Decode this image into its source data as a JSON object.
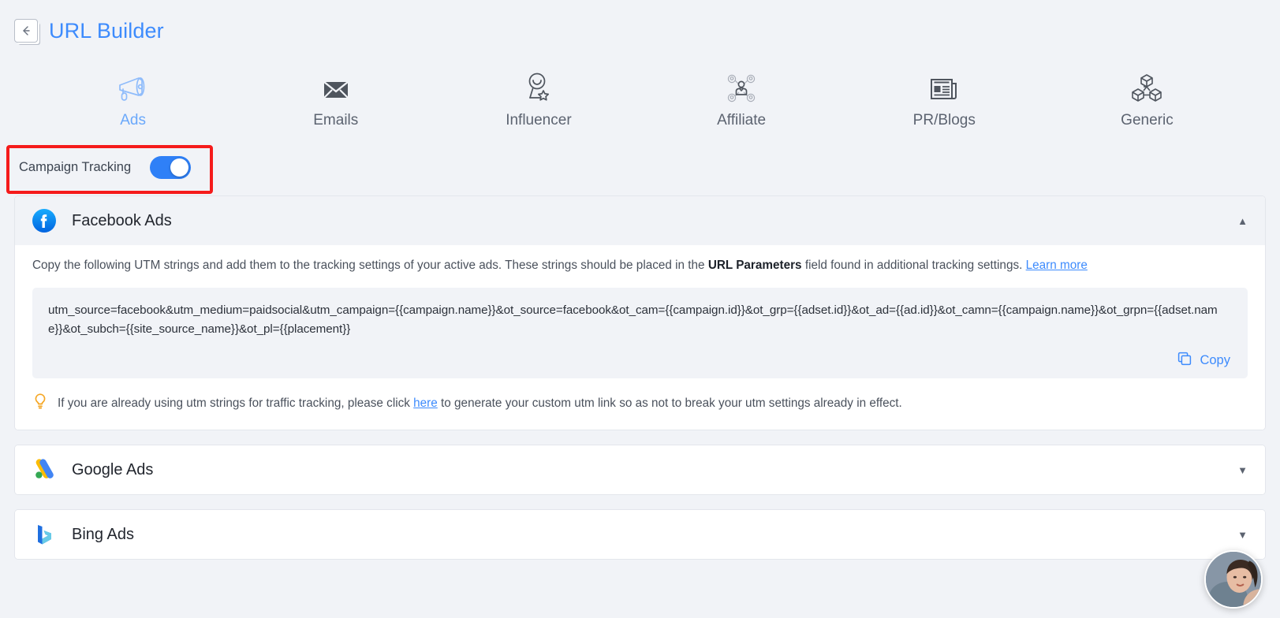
{
  "header": {
    "back_icon": "back-arrow-icon",
    "title": "URL Builder"
  },
  "tabs": [
    {
      "label": "Ads",
      "icon": "megaphone-icon",
      "active": true
    },
    {
      "label": "Emails",
      "icon": "envelope-icon",
      "active": false
    },
    {
      "label": "Influencer",
      "icon": "influencer-icon",
      "active": false
    },
    {
      "label": "Affiliate",
      "icon": "affiliate-network-icon",
      "active": false
    },
    {
      "label": "PR/Blogs",
      "icon": "newspaper-icon",
      "active": false
    },
    {
      "label": "Generic",
      "icon": "cubes-icon",
      "active": false
    }
  ],
  "tracking": {
    "label": "Campaign Tracking",
    "enabled": true,
    "highlight_color": "#f51b1b"
  },
  "cards": [
    {
      "title": "Facebook Ads",
      "icon": "facebook-icon",
      "expanded": true,
      "chevron": "▲",
      "description_part1": "Copy the following UTM strings and add them to the tracking settings of your active ads. These strings should be placed in the ",
      "description_bold": "URL Parameters",
      "description_part2": " field found in additional tracking settings. ",
      "description_link": "Learn more",
      "utm_string": "utm_source=facebook&utm_medium=paidsocial&utm_campaign={{campaign.name}}&ot_source=facebook&ot_cam={{campaign.id}}&ot_grp={{adset.id}}&ot_ad={{ad.id}}&ot_camn={{campaign.name}}&ot_grpn={{adset.name}}&ot_subch={{site_source_name}}&ot_pl={{placement}}",
      "copy_label": "Copy",
      "copy_icon": "copy-icon",
      "hint_icon": "lightbulb-icon",
      "hint_part1": "If you are already using utm strings for traffic tracking, please click ",
      "hint_link": "here",
      "hint_part2": " to generate your custom utm link so as not to break your utm settings already in effect."
    },
    {
      "title": "Google Ads",
      "icon": "google-ads-icon",
      "expanded": false,
      "chevron": "▼"
    },
    {
      "title": "Bing Ads",
      "icon": "bing-icon",
      "expanded": false,
      "chevron": "▼"
    }
  ],
  "avatar": {
    "name": "support-avatar"
  },
  "colors": {
    "accent_blue": "#3d8bfd",
    "toggle_blue": "#2f80f7",
    "page_bg": "#f1f3f7",
    "annotation_red": "#f51b1b"
  }
}
